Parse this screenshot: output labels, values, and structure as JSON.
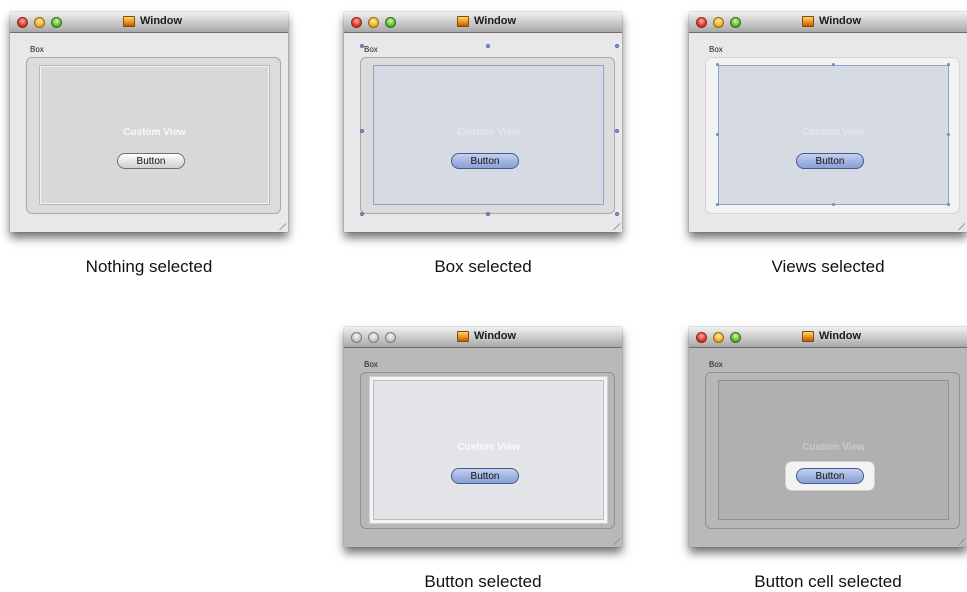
{
  "windows": [
    {
      "title": "Window",
      "box_label": "Box",
      "custom_view_label": "Custom View",
      "button_label": "Button",
      "caption": "Nothing selected"
    },
    {
      "title": "Window",
      "box_label": "Box",
      "custom_view_label": "Custom View",
      "button_label": "Button",
      "caption": "Box selected"
    },
    {
      "title": "Window",
      "box_label": "Box",
      "custom_view_label": "Custom View",
      "button_label": "Button",
      "caption": "Views selected"
    },
    {
      "title": "Window",
      "box_label": "Box",
      "custom_view_label": "Custom View",
      "button_label": "Button",
      "caption": "Button selected"
    },
    {
      "title": "Window",
      "box_label": "Box",
      "custom_view_label": "Custom View",
      "button_label": "Button",
      "caption": "Button cell selected"
    }
  ],
  "colors": {
    "selection_blue": "#7f9fd7",
    "button_selected": "#9fb3e0",
    "window_background": "#e8e8e8",
    "window_dimmed": "#b9b9b9"
  }
}
